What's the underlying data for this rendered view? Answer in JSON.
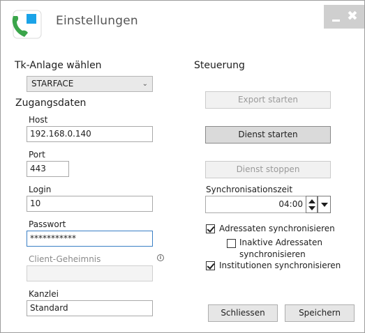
{
  "window": {
    "title": "Einstellungen",
    "close_glyph": "✖",
    "colors": {
      "titlebar_controls": "#cfcfcf",
      "logo_blue": "#1aa3e8",
      "logo_green": "#3aa54a"
    }
  },
  "left": {
    "tk_section": "Tk-Anlage wählen",
    "tk_select_value": "STARFACE",
    "access_section": "Zugangsdaten",
    "host_label": "Host",
    "host_value": "192.168.0.140",
    "port_label": "Port",
    "port_value": "443",
    "login_label": "Login",
    "login_value": "10",
    "password_label": "Passwort",
    "password_value": "***********",
    "client_secret_label": "Client-Geheimnis",
    "client_secret_value": "",
    "kanzlei_label": "Kanzlei",
    "kanzlei_value": "Standard"
  },
  "right": {
    "control_section": "Steuerung",
    "export_button": "Export starten",
    "start_button": "Dienst starten",
    "stop_button": "Dienst stoppen",
    "sync_time_label": "Synchronisationszeit",
    "sync_time_value": "04:00",
    "cb_addressees": "Adressaten synchronisieren",
    "cb_addressees_checked": true,
    "cb_inactive_line1": "Inaktive Adressaten",
    "cb_inactive_line2": "synchronisieren",
    "cb_inactive_checked": false,
    "cb_institutions": "Institutionen synchronisieren",
    "cb_institutions_checked": true
  },
  "footer": {
    "close_button": "Schliessen",
    "save_button": "Speichern"
  }
}
